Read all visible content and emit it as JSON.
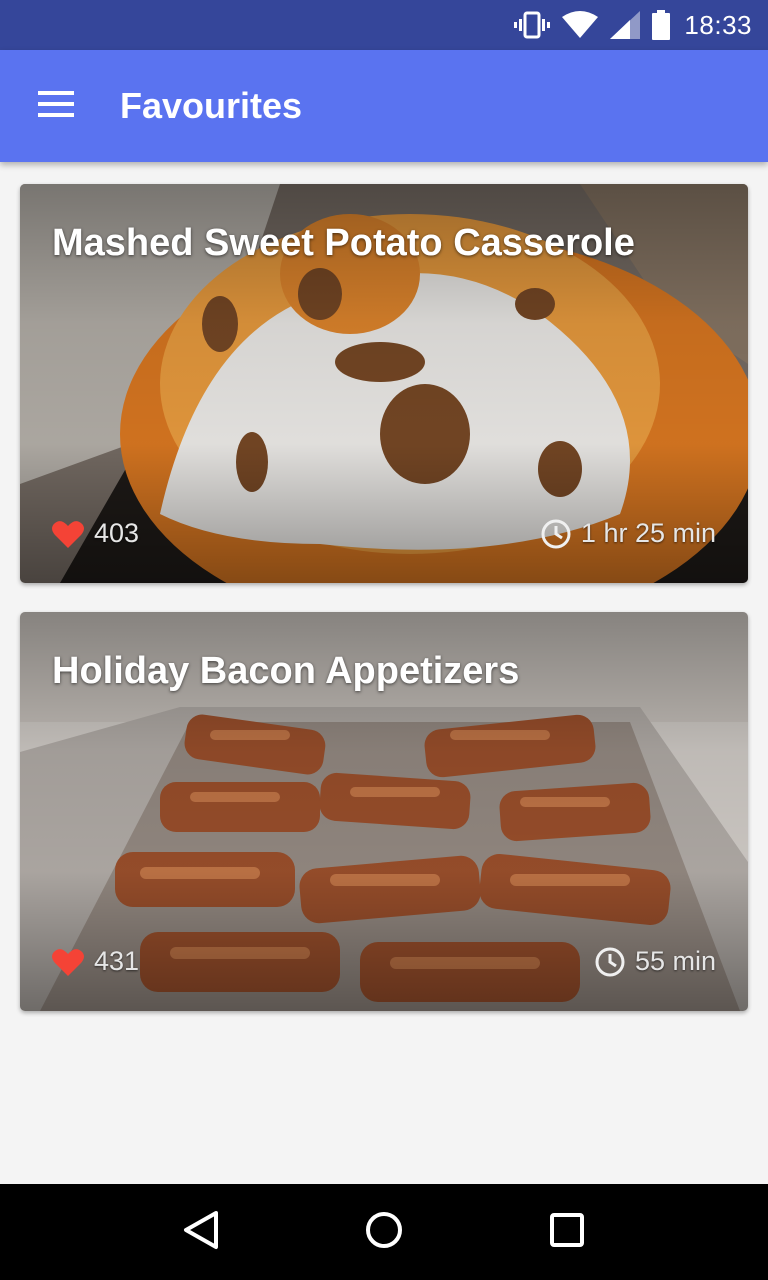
{
  "status_bar": {
    "time": "18:33",
    "icons": [
      "vibrate-icon",
      "wifi-icon",
      "signal-icon",
      "battery-icon"
    ],
    "color": "#35469a"
  },
  "app_bar": {
    "title": "Favourites",
    "menu_icon": "hamburger-menu-icon",
    "color": "#5a73f0"
  },
  "recipes": [
    {
      "title": "Mashed Sweet Potato Casserole",
      "likes": "403",
      "time": "1 hr 25 min"
    },
    {
      "title": "Holiday Bacon Appetizers",
      "likes": "431",
      "time": "55 min"
    }
  ],
  "nav_bar": {
    "buttons": [
      "back-icon",
      "home-icon",
      "recents-icon"
    ]
  },
  "colors": {
    "heart": "#f44336",
    "background": "#f4f4f4"
  }
}
